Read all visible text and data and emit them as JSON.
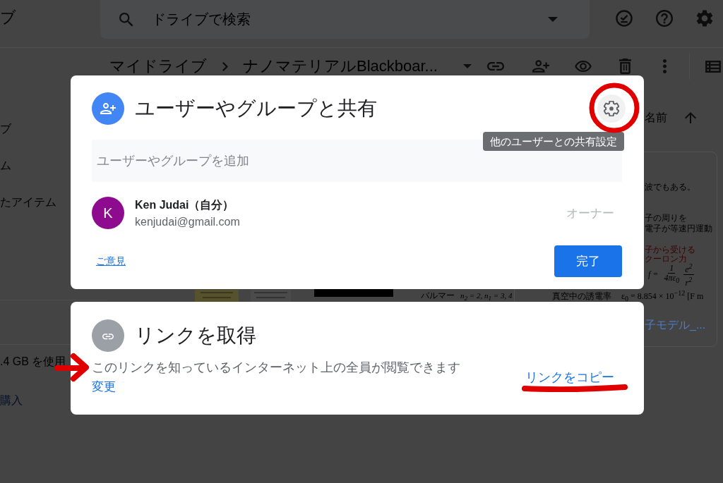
{
  "app_bar": {
    "logo_text": "ブ",
    "search": {
      "placeholder": "ドライブで検索"
    }
  },
  "sidebar": {
    "items": [
      {
        "label": "ブ"
      },
      {
        "label": "ム"
      },
      {
        "label": "たアイテム"
      }
    ],
    "storage": ".4 GB を使用",
    "buy_link": "購入"
  },
  "breadcrumb": {
    "items": [
      {
        "label": "マイドライブ"
      },
      {
        "label": "ナノマテリアルBlackboar..."
      }
    ]
  },
  "sort": {
    "label": "名前"
  },
  "file_grid": {
    "preview_labels": [
      {
        "text": "バルマー"
      },
      {
        "text": "n$_{2}$ = 2, n$_{1}$ = 3, 4"
      }
    ],
    "card": {
      "paragraphs": [
        [
          "波でもある。"
        ],
        [
          "子の周りを",
          "電子が等速円運動"
        ]
      ],
      "highlight_line": "子から受けるクーロン力",
      "formula": {
        "lhs": "f =",
        "fractions": [
          {
            "numerator": "1",
            "denominator": "4πε$_{0}$"
          },
          {
            "numerator": "e$^{2}$",
            "denominator": "r$^{2}$"
          }
        ]
      },
      "constant_label": "真空中の誘電率",
      "constant_value": "ε$_{0}$ = 8.854 × 10$^{−12}$ [F m",
      "file_name": "子モデル_..."
    }
  },
  "share_dialog": {
    "title": "ユーザーやグループと共有",
    "settings_tooltip": "他のユーザーとの共有設定",
    "add_field": {
      "placeholder": "ユーザーやグループを追加"
    },
    "people": [
      {
        "initial": "K",
        "name": "Ken Judai（自分）",
        "email": "kenjudai@gmail.com",
        "role": "オーナー"
      }
    ],
    "feedback_link": "ご意見",
    "done_button": "完了"
  },
  "link_dialog": {
    "title": "リンクを取得",
    "description": "このリンクを知っているインターネット上の全員が閲覧できます",
    "change_link": "変更",
    "copy_link": "リンクをコピー"
  },
  "annotations": [
    {
      "kind": "circle"
    },
    {
      "kind": "arrow"
    },
    {
      "kind": "underline"
    }
  ]
}
